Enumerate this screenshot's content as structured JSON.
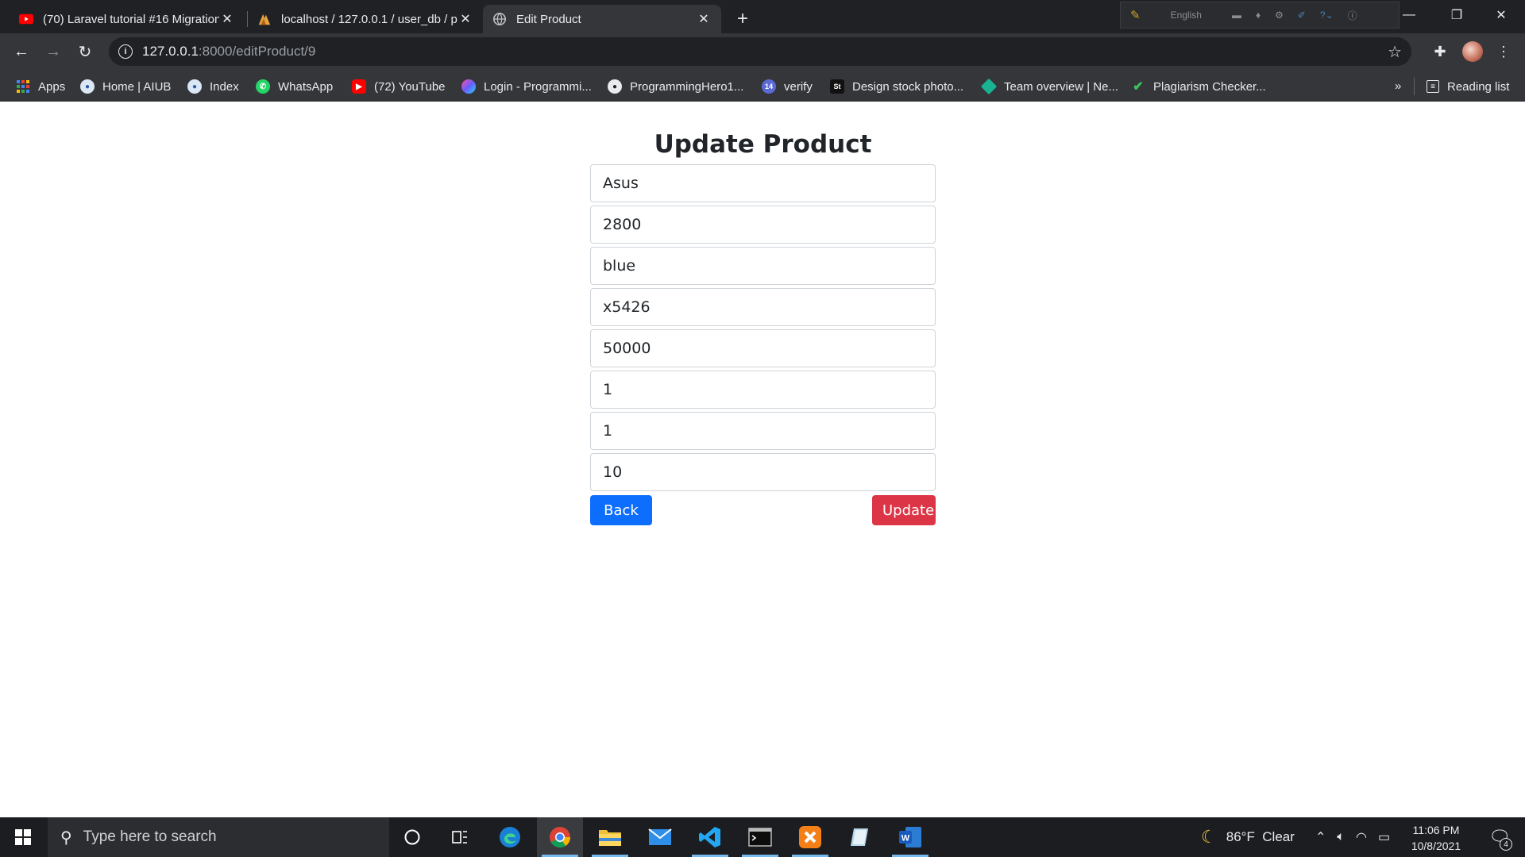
{
  "browser": {
    "tabs": [
      {
        "title": "(70) Laravel tutorial #16 Migration",
        "favicon": "youtube-icon"
      },
      {
        "title": "localhost / 127.0.0.1 / user_db / p",
        "favicon": "phpmyadmin-icon"
      },
      {
        "title": "Edit Product",
        "favicon": "globe-icon",
        "active": true
      }
    ],
    "language_widget": "English",
    "url_host": "127.0.0.1",
    "url_path": ":8000/editProduct/9"
  },
  "bookmarks": [
    {
      "label": "Apps",
      "icon": "apps-grid-icon"
    },
    {
      "label": "Home | AIUB",
      "icon": "aiub-icon"
    },
    {
      "label": "Index",
      "icon": "aiub-icon"
    },
    {
      "label": "WhatsApp",
      "icon": "whatsapp-icon"
    },
    {
      "label": "(72) YouTube",
      "icon": "youtube-icon"
    },
    {
      "label": "Login - Programmi...",
      "icon": "programming-hero-icon"
    },
    {
      "label": "ProgrammingHero1...",
      "icon": "github-icon"
    },
    {
      "label": "verify",
      "icon": "verify-icon"
    },
    {
      "label": "Design stock photo...",
      "icon": "shutterstock-icon"
    },
    {
      "label": "Team overview | Ne...",
      "icon": "diamond-icon"
    },
    {
      "label": "Plagiarism Checker...",
      "icon": "plagiarism-icon"
    }
  ],
  "bookmarks_overflow": "»",
  "reading_list": "Reading list",
  "form": {
    "title": "Update Product",
    "fields": [
      "Asus",
      "2800",
      "blue",
      "x5426",
      "50000",
      "1",
      "1",
      "10"
    ],
    "back_label": "Back",
    "update_label": "Update"
  },
  "colors": {
    "primary": "#0d6efd",
    "danger": "#dc3545",
    "browser_frame": "#202124",
    "toolbar": "#35363a"
  },
  "taskbar": {
    "search_placeholder": "Type here to search",
    "weather": "86°F  Clear",
    "time": "11:06 PM",
    "date": "10/8/2021",
    "notification_count": "4"
  }
}
